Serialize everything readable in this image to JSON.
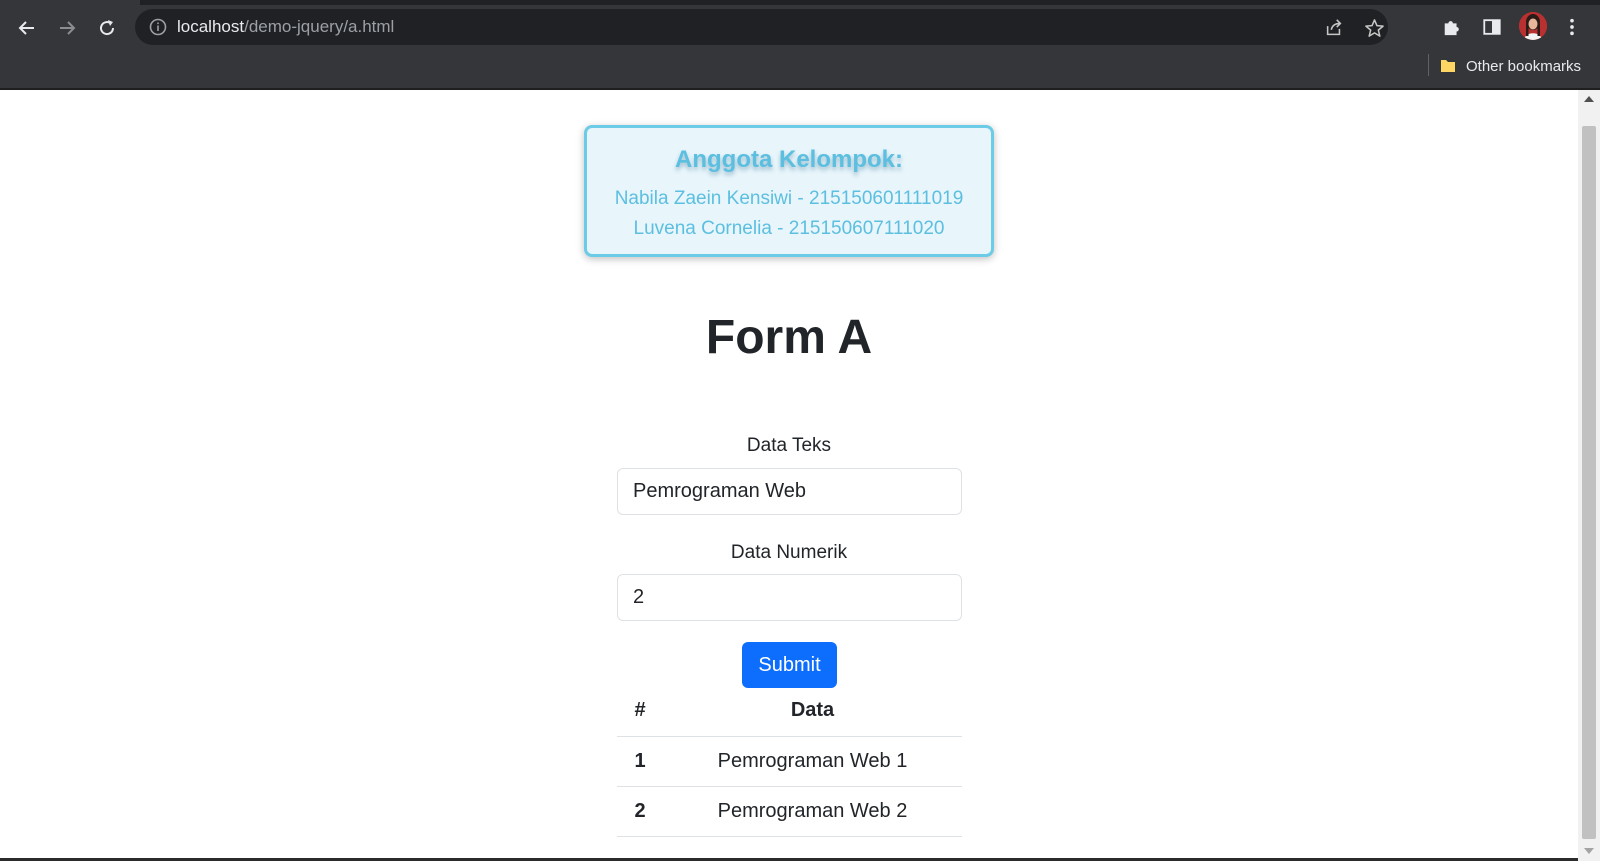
{
  "browser": {
    "url_host": "localhost",
    "url_path": "/demo-jquery/a.html",
    "bookmarks": {
      "other_label": "Other bookmarks"
    }
  },
  "members": {
    "heading": "Anggota Kelompok:",
    "list": [
      "Nabila Zaein Kensiwi - 215150601111019",
      "Luvena Cornelia - 215150607111020"
    ]
  },
  "form": {
    "title": "Form A",
    "text_label": "Data Teks",
    "text_value": "Pemrograman Web",
    "number_label": "Data Numerik",
    "number_value": "2",
    "submit_label": "Submit"
  },
  "table": {
    "headers": [
      "#",
      "Data"
    ],
    "rows": [
      [
        "1",
        "Pemrograman Web 1"
      ],
      [
        "2",
        "Pemrograman Web 2"
      ]
    ]
  },
  "colors": {
    "accent": "#0d6efd",
    "member_box_border": "#6ccbe6",
    "member_text": "#5cbfe0"
  }
}
